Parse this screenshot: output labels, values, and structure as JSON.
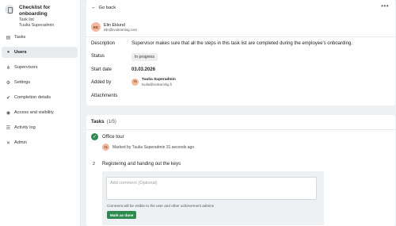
{
  "sidebar": {
    "title": "Checklist for onboarding",
    "subtitle1": "Task list",
    "subtitle2": "Tuulia Superadmin",
    "items": [
      {
        "label": "Tasks",
        "icon": "clipboard-icon"
      },
      {
        "label": "Users",
        "icon": "user-icon"
      },
      {
        "label": "Supervisors",
        "icon": "hierarchy-icon"
      },
      {
        "label": "Settings",
        "icon": "gear-icon"
      },
      {
        "label": "Completion details",
        "icon": "check-circle-icon"
      },
      {
        "label": "Access and visibility",
        "icon": "eye-icon"
      },
      {
        "label": "Activity log",
        "icon": "list-icon"
      },
      {
        "label": "Admin",
        "icon": "tools-icon"
      }
    ],
    "active_index": 1
  },
  "header": {
    "back_label": "Go back",
    "more_label": "•••"
  },
  "user": {
    "initials": "EE",
    "name": "Elin Eklund",
    "email": "elin@ivolearning.com"
  },
  "details": {
    "description_label": "Description",
    "description_value": "Supervisor makes sure that all the steps in this task list are completed during the employee's onboarding.",
    "status_label": "Status",
    "status_value": "In progress",
    "start_label": "Start date",
    "start_value": "03.03.2026",
    "added_label": "Added by",
    "added_initials": "TS",
    "added_name": "Tuulia Superadmin",
    "added_email": "tuulia@ivolearning.fi",
    "attachments_label": "Attachments"
  },
  "tasks": {
    "heading": "Tasks",
    "count": "(1/5)",
    "items": [
      {
        "title": "Office tour",
        "marked_initials": "TS",
        "marked_text": "Marked by Tuulia Superadmin 31 seconds ago"
      },
      {
        "number": "2",
        "title": "Registering and handing out the keys",
        "comment_placeholder": "Add comment (Optional)",
        "hint": "Comment will be visible to the user and other achievement admins",
        "button_label": "Mark as done"
      }
    ]
  },
  "colors": {
    "accent_green": "#2e8a4f",
    "avatar_bg": "#f3b9a0",
    "page_bg": "#eef1f3"
  }
}
